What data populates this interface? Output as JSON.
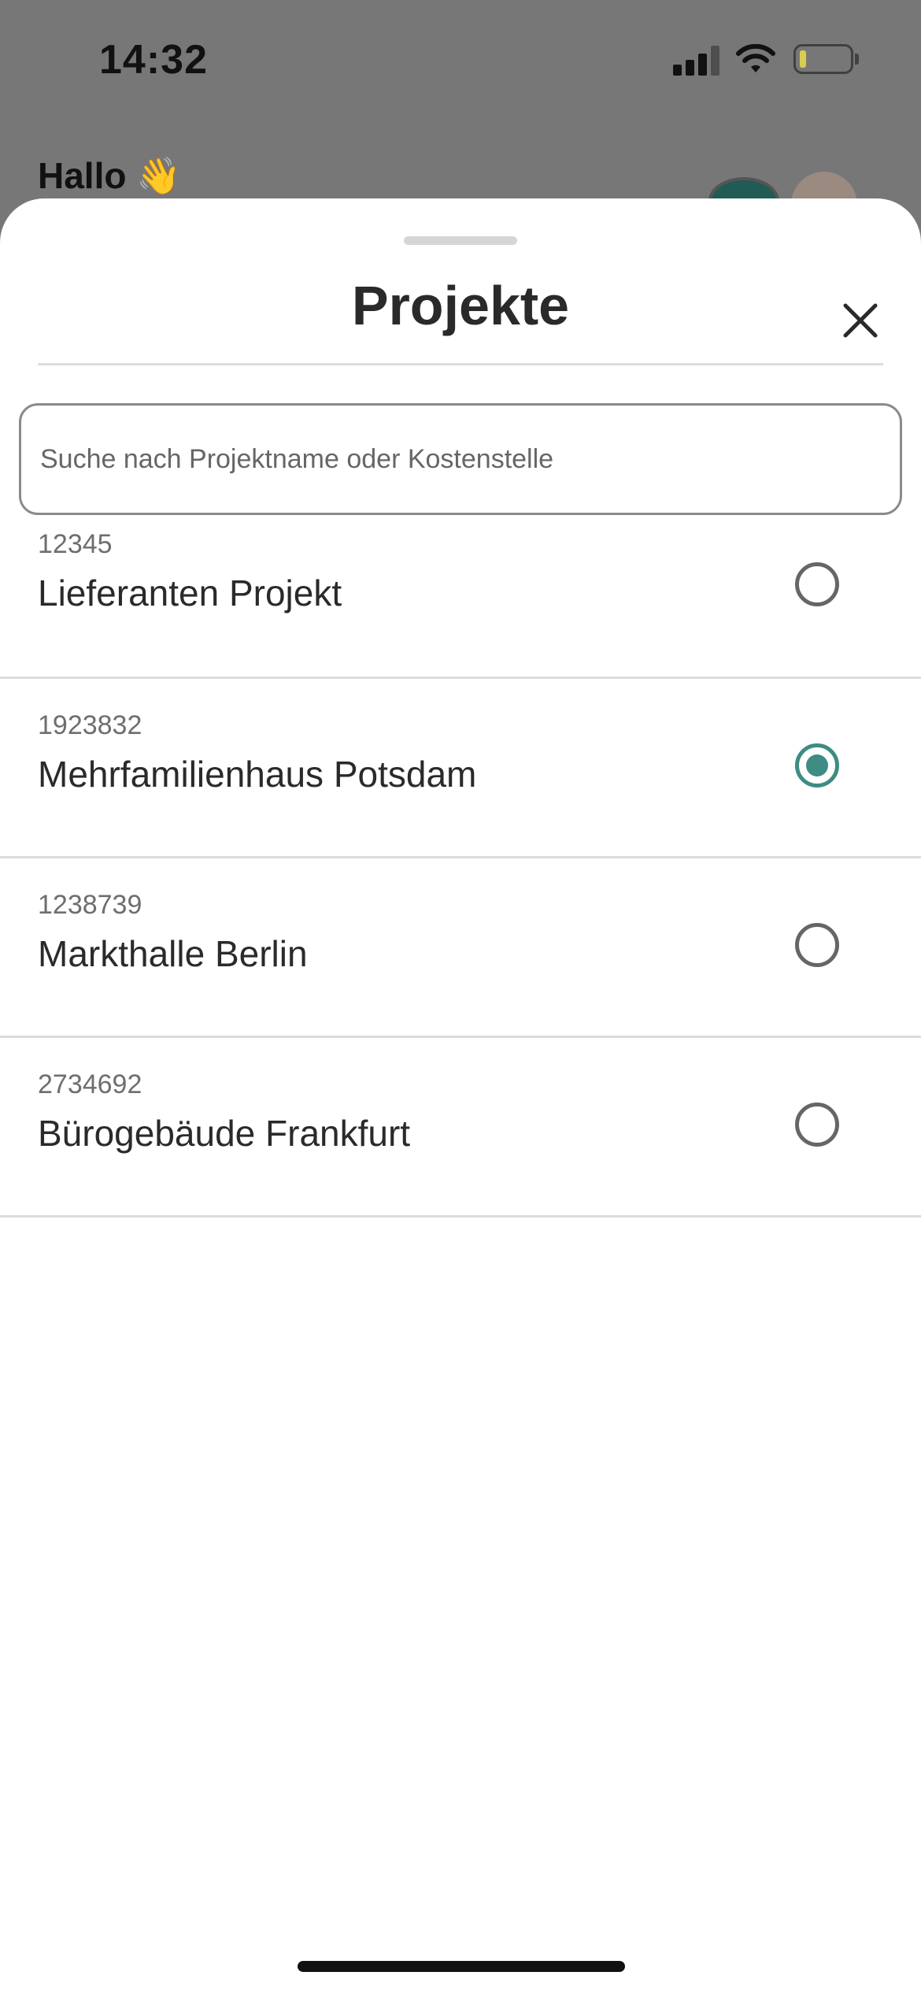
{
  "status_bar": {
    "time": "14:32"
  },
  "background": {
    "greeting": "Hallo",
    "greeting_emoji": "👋"
  },
  "sheet": {
    "title": "Projekte",
    "close_icon": "close-icon",
    "search": {
      "placeholder": "Suche nach Projektname oder Kostenstelle",
      "value": ""
    },
    "projects": [
      {
        "code": "12345",
        "name": "Lieferanten Projekt",
        "selected": false
      },
      {
        "code": "1923832",
        "name": "Mehrfamilienhaus Potsdam",
        "selected": true
      },
      {
        "code": "1238739",
        "name": "Markthalle Berlin",
        "selected": false
      },
      {
        "code": "2734692",
        "name": "Bürogebäude Frankfurt",
        "selected": false
      }
    ]
  },
  "colors": {
    "accent": "#3e8c83",
    "overlay": "#777777",
    "divider": "#dcdcdc"
  }
}
